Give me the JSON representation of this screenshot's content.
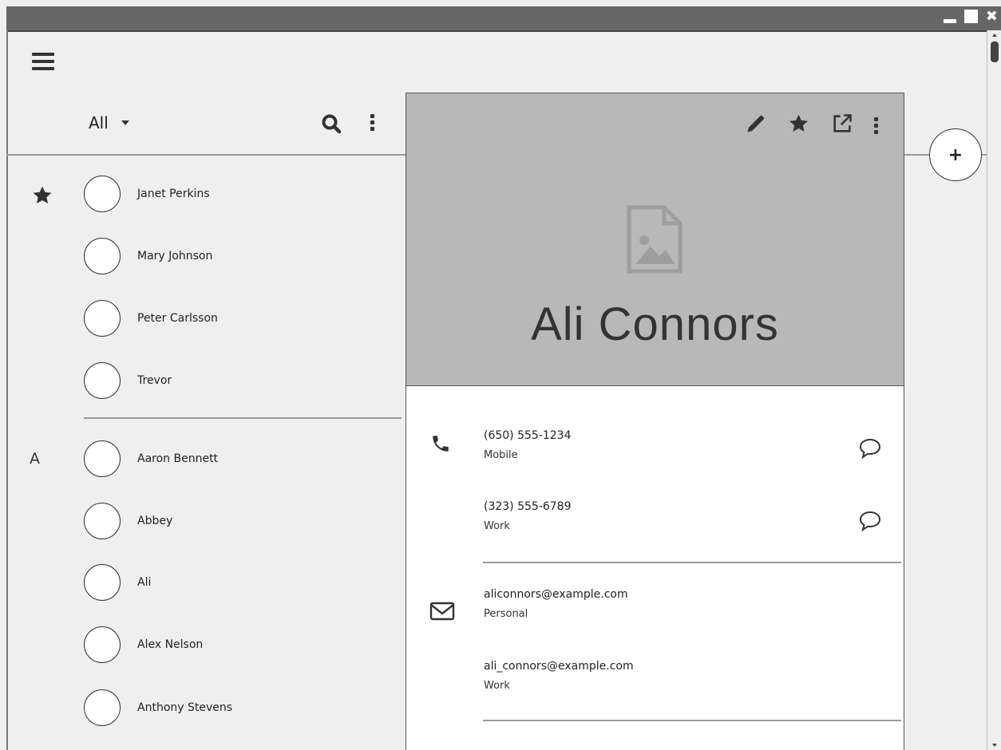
{
  "window": {
    "controls": [
      "minimize",
      "maximize",
      "close"
    ],
    "close_glyph": "✖"
  },
  "toolbar": {
    "filter_label": "All"
  },
  "groups": {
    "starred_icon": "star-icon",
    "letter_a": "A"
  },
  "contacts": [
    {
      "name": "Janet Perkins",
      "group": "starred"
    },
    {
      "name": "Mary Johnson",
      "group": "starred"
    },
    {
      "name": "Peter Carlsson",
      "group": "starred"
    },
    {
      "name": "Trevor",
      "group": "starred"
    },
    {
      "name": "Aaron Bennett",
      "group": "A"
    },
    {
      "name": "Abbey",
      "group": "A"
    },
    {
      "name": "Ali",
      "group": "A"
    },
    {
      "name": "Alex Nelson",
      "group": "A"
    },
    {
      "name": "Anthony Stevens",
      "group": "A"
    }
  ],
  "detail": {
    "name": "Ali Connors",
    "header_actions": [
      "pencil-icon",
      "star-icon",
      "open-external-icon",
      "more-vert-icon"
    ],
    "phones": [
      {
        "value": "(650) 555-1234",
        "label": "Mobile"
      },
      {
        "value": "(323) 555-6789",
        "label": "Work"
      }
    ],
    "emails": [
      {
        "value": "aliconnors@example.com",
        "label": "Personal"
      },
      {
        "value": "ali_connors@example.com",
        "label": "Work"
      }
    ]
  },
  "fab": {
    "label": "+"
  },
  "colors": {
    "hero_bg": "#b8b8b8",
    "page_bg": "#efefef",
    "titlebar": "#666666"
  }
}
